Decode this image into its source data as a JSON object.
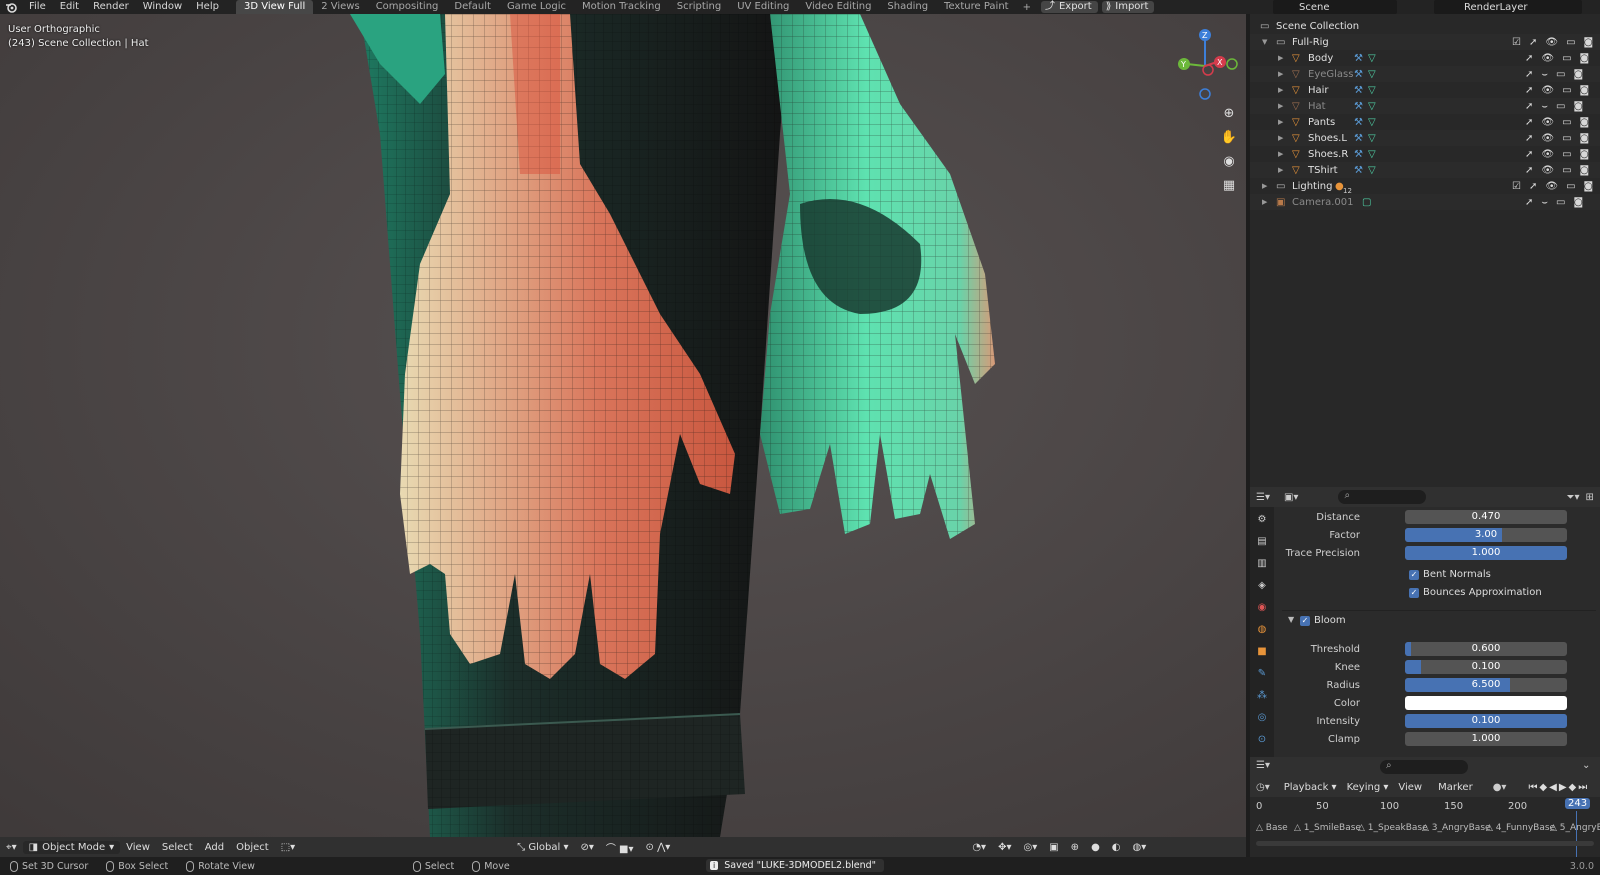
{
  "menu": [
    "File",
    "Edit",
    "Render",
    "Window",
    "Help"
  ],
  "workspaces": [
    "3D View Full",
    "2 Views",
    "Compositing",
    "Default",
    "Game Logic",
    "Motion Tracking",
    "Scripting",
    "UV Editing",
    "Video Editing",
    "Shading",
    "Texture Paint"
  ],
  "active_workspace": "3D View Full",
  "export_label": "Export",
  "import_label": "Import",
  "scene_name": "Scene",
  "render_layer": "RenderLayer",
  "viewport": {
    "view_name": "User Orthographic",
    "context": "(243) Scene Collection | Hat"
  },
  "outliner": {
    "root": "Scene Collection",
    "collection": "Full-Rig",
    "objects": [
      {
        "name": "Body",
        "dim": false
      },
      {
        "name": "EyeGlass",
        "dim": true
      },
      {
        "name": "Hair",
        "dim": false
      },
      {
        "name": "Hat",
        "dim": true
      },
      {
        "name": "Pants",
        "dim": false
      },
      {
        "name": "Shoes.L",
        "dim": false
      },
      {
        "name": "Shoes.R",
        "dim": false
      },
      {
        "name": "TShirt",
        "dim": false
      }
    ],
    "lighting": "Lighting",
    "lighting_count": "12",
    "camera": "Camera.001"
  },
  "properties": {
    "distance_label": "Distance",
    "distance": "0.470",
    "distance_frac": 0.0,
    "factor_label": "Factor",
    "factor": "3.00",
    "factor_frac": 0.6,
    "trace_label": "Trace Precision",
    "trace": "1.000",
    "trace_frac": 1.0,
    "bent_normals": "Bent Normals",
    "bounces": "Bounces Approximation",
    "bloom": "Bloom",
    "threshold_label": "Threshold",
    "threshold": "0.600",
    "threshold_frac": 0.04,
    "knee_label": "Knee",
    "knee": "0.100",
    "knee_frac": 0.1,
    "radius_label": "Radius",
    "radius": "6.500",
    "radius_frac": 0.65,
    "color_label": "Color",
    "color_value": "#ffffff",
    "intensity_label": "Intensity",
    "intensity": "0.100",
    "intensity_frac": 1.0,
    "clamp_label": "Clamp",
    "clamp": "1.000",
    "clamp_frac": 0.0
  },
  "vp_header": {
    "mode": "Object Mode",
    "view": "View",
    "select": "Select",
    "add": "Add",
    "object": "Object",
    "orientation": "Global"
  },
  "timeline": {
    "playback": "Playback",
    "keying": "Keying",
    "view": "View",
    "marker": "Marker",
    "ticks": [
      "0",
      "50",
      "100",
      "150",
      "200"
    ],
    "current_frame": "243",
    "markers": [
      "Base",
      "1_SmileBase",
      "1_SpeakBase",
      "3_AngryBase",
      "4_FunnyBase",
      "5_AngryB"
    ]
  },
  "status": {
    "cursor": "Set 3D Cursor",
    "box": "Box Select",
    "rotate": "Rotate View",
    "select": "Select",
    "move": "Move",
    "saved": "Saved \"LUKE-3DMODEL2.blend\"",
    "version": "3.0.0"
  },
  "colors": {
    "accent": "#4772b3",
    "object_icon": "#e8943a",
    "mesh_icon": "#4fd1a6",
    "modifier_icon": "#5b9bd5"
  }
}
